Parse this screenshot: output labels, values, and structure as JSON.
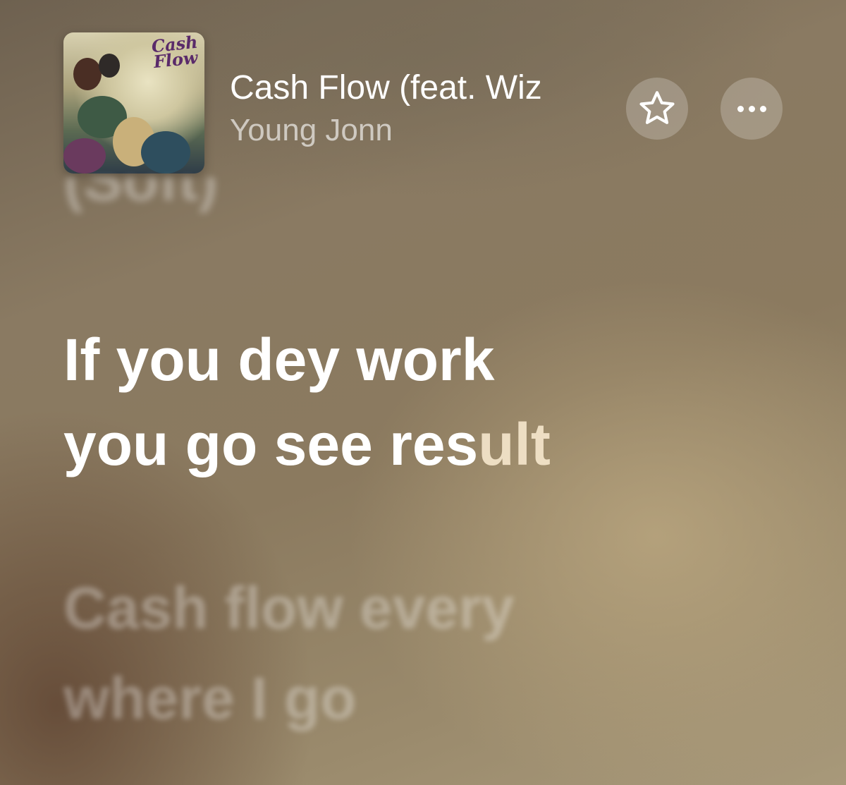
{
  "now_playing": {
    "title": "Cash Flow (feat. Wiz",
    "artist": "Young Jonn",
    "album_art_text": "Cash Flow"
  },
  "controls": {
    "favorite_icon": "star-icon",
    "more_icon": "ellipsis-icon"
  },
  "lyrics": {
    "previous": "(Soft)",
    "current_line_1": "If you dey work",
    "current_line_2_sung": "you go see res",
    "current_line_2_pending": "ult",
    "next_line_1": "Cash flow every",
    "next_line_2": "where I go"
  },
  "colors": {
    "lyric_active": "#ffffff",
    "accent_art_title": "#5a2a6a"
  }
}
